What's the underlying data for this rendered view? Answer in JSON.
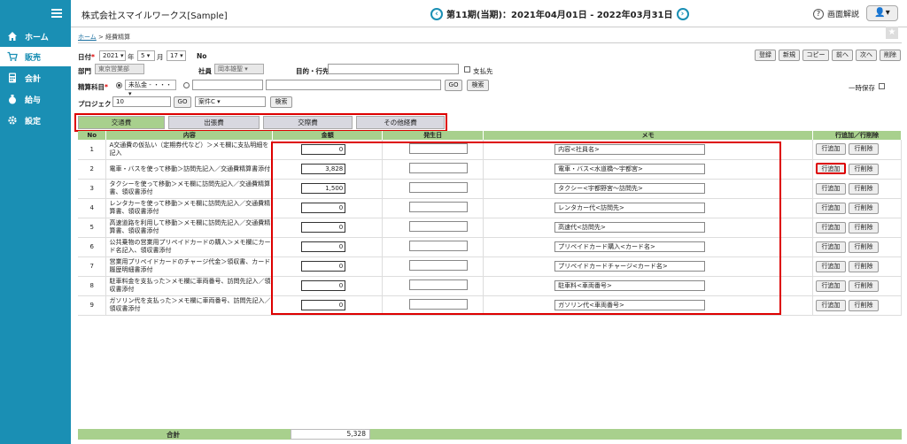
{
  "sidebar": {
    "items": [
      {
        "label": "ホーム",
        "icon": "home-icon"
      },
      {
        "label": "販売",
        "icon": "cart-icon"
      },
      {
        "label": "会計",
        "icon": "calculator-icon"
      },
      {
        "label": "給与",
        "icon": "moneybag-icon"
      },
      {
        "label": "設定",
        "icon": "gear-icon"
      }
    ]
  },
  "header": {
    "company": "株式会社スマイルワークス[Sample]",
    "period": "第11期(当期)：2021年04月01日 - 2022年03月31日",
    "help": "画面解説"
  },
  "breadcrumb": {
    "home": "ホーム",
    "sep": ">",
    "current": "経費精算"
  },
  "form": {
    "date_label": "日付",
    "year": "2021",
    "year_unit": "年",
    "month": "5",
    "month_unit": "月",
    "day": "17",
    "no_label": "No",
    "dept_label": "部門",
    "dept_value": "東京営業部",
    "staff_label": "社員",
    "staff_value": "岡本雄聖",
    "purpose_label": "目的・行先",
    "payee_label": "支払先",
    "account_label": "精算科目",
    "account_value": "未払金 - ・・・",
    "go1": "GO",
    "search1": "検索",
    "project_label": "プロジェクト",
    "project_code": "10",
    "go2": "GO",
    "project_name": "案件C",
    "search2": "検索",
    "temp_save": "一時保存"
  },
  "toolbar": [
    "登録",
    "新規",
    "コピー",
    "前へ",
    "次へ",
    "削除"
  ],
  "tabs": [
    "交通費",
    "出張費",
    "交際費",
    "その他経費"
  ],
  "table": {
    "headers": [
      "No",
      "内容",
      "金額",
      "発生日",
      "メモ",
      "行追加／行削除"
    ],
    "add_label": "行追加",
    "del_label": "行削除",
    "rows": [
      {
        "no": "1",
        "desc": "A交通費の仮払い（定期券代など）＞メモ欄に支払明細を記入",
        "amount": "0",
        "memo": "内容<社員名>"
      },
      {
        "no": "2",
        "desc": "電車・バスを使って移動＞訪問先記入／交通費精算書添付",
        "amount": "3,828",
        "memo": "電車・バス<水道橋～宇都宮>"
      },
      {
        "no": "3",
        "desc": "タクシーを使って移動＞メモ欄に訪問先記入／交通費精算書、領収書添付",
        "amount": "1,500",
        "memo": "タクシー<宇都野宮～訪問先>"
      },
      {
        "no": "4",
        "desc": "レンタカーを使って移動＞メモ欄に訪問先記入／交通費精算書、領収書添付",
        "amount": "0",
        "memo": "レンタカー代<訪問先>"
      },
      {
        "no": "5",
        "desc": "高速道路を利用して移動＞メモ欄に訪問先記入／交通費精算書、領収書添付",
        "amount": "0",
        "memo": "高速代<訪問先>"
      },
      {
        "no": "6",
        "desc": "公共乗物の営業用プリペイドカードの購入＞メモ欄にカード名記入、領収書添付",
        "amount": "0",
        "memo": "プリペイドカード購入<カード名>"
      },
      {
        "no": "7",
        "desc": "営業用プリペイドカードのチャージ代金＞領収書、カード履歴明細書添付",
        "amount": "0",
        "memo": "プリペイドカードチャージ<カード名>"
      },
      {
        "no": "8",
        "desc": "駐車料金を支払った＞メモ欄に車両番号、訪問先記入／領収書添付",
        "amount": "0",
        "memo": "駐車料<車両番号>"
      },
      {
        "no": "9",
        "desc": "ガソリン代を支払った＞メモ欄に車両番号、訪問先記入／領収書添付",
        "amount": "0",
        "memo": "ガソリン代<車両番号>"
      }
    ]
  },
  "total": {
    "label": "合計",
    "value": "5,328"
  }
}
